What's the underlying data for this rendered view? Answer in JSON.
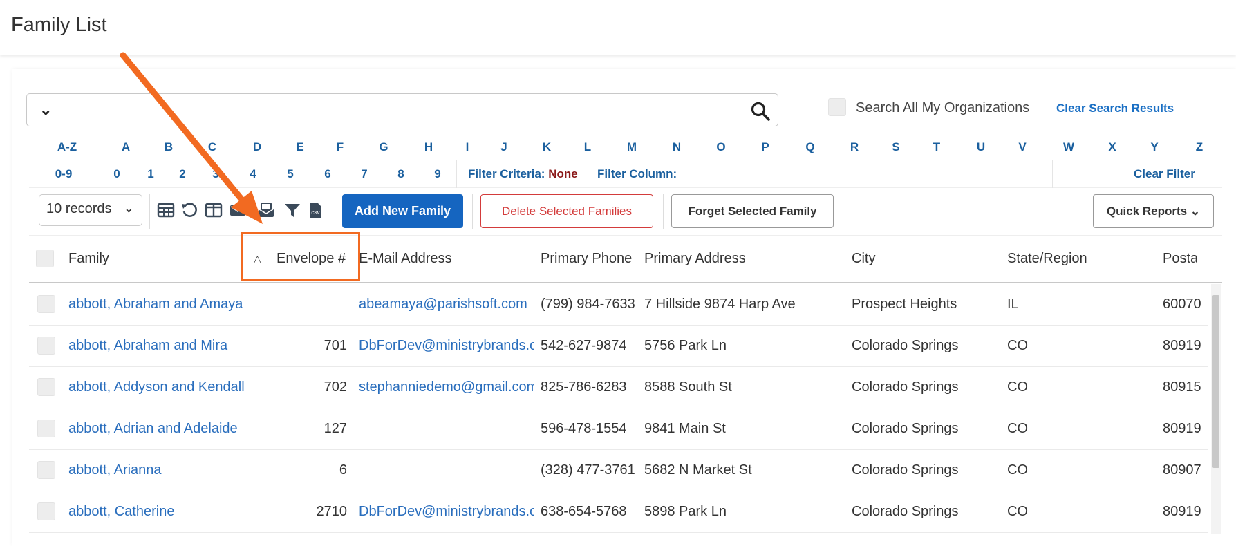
{
  "page": {
    "title": "Family List"
  },
  "search": {
    "placeholder": "",
    "search_all_label": "Search All My Organizations",
    "clear_results_label": "Clear Search Results"
  },
  "alphabet": [
    "A-Z",
    "A",
    "B",
    "C",
    "D",
    "E",
    "F",
    "G",
    "H",
    "I",
    "J",
    "K",
    "L",
    "M",
    "N",
    "O",
    "P",
    "Q",
    "R",
    "S",
    "T",
    "U",
    "V",
    "W",
    "X",
    "Y",
    "Z"
  ],
  "numbers": [
    "0-9",
    "0",
    "1",
    "2",
    "3",
    "4",
    "5",
    "6",
    "7",
    "8",
    "9"
  ],
  "filter": {
    "criteria_label": "Filter Criteria:",
    "criteria_value": "None",
    "column_label": "Filter Column:",
    "clear_label": "Clear Filter"
  },
  "toolbar": {
    "records_value": "10 records",
    "icons": [
      "table-icon",
      "refresh-icon",
      "columns-icon",
      "mail-icon",
      "mail-merge-icon",
      "filter-icon",
      "csv-icon"
    ],
    "add_label": "Add New Family",
    "delete_label": "Delete Selected Families",
    "forget_label": "Forget Selected Family",
    "quick_reports_label": "Quick Reports"
  },
  "table": {
    "headers": {
      "family": "Family",
      "envelope": "Envelope #",
      "email": "E-Mail Address",
      "phone": "Primary Phone",
      "address": "Primary Address",
      "city": "City",
      "state": "State/Region",
      "postal": "Postal Code"
    },
    "rows": [
      {
        "family": "abbott, Abraham and Amaya",
        "envelope": "",
        "email": "abeamaya@parishsoft.com",
        "phone": "(799) 984-7633",
        "address": "7 Hillside 9874 Harp Ave",
        "city": "Prospect Heights",
        "state": "IL",
        "postal": "60070"
      },
      {
        "family": "abbott, Abraham and Mira",
        "envelope": "701",
        "email": "DbForDev@ministrybrands.com",
        "phone": "542-627-9874",
        "address": "5756 Park Ln",
        "city": "Colorado Springs",
        "state": "CO",
        "postal": "80919"
      },
      {
        "family": "abbott, Addyson and Kendall",
        "envelope": "702",
        "email": "stephanniedemo@gmail.com",
        "phone": "825-786-6283",
        "address": "8588 South St",
        "city": "Colorado Springs",
        "state": "CO",
        "postal": "80915"
      },
      {
        "family": "abbott, Adrian and Adelaide",
        "envelope": "127",
        "email": "",
        "phone": "596-478-1554",
        "address": "9841 Main St",
        "city": "Colorado Springs",
        "state": "CO",
        "postal": "80919"
      },
      {
        "family": "abbott, Arianna",
        "envelope": "6",
        "email": "",
        "phone": "(328) 477-3761",
        "address": "5682 N Market St",
        "city": "Colorado Springs",
        "state": "CO",
        "postal": "80907"
      },
      {
        "family": "abbott, Catherine",
        "envelope": "2710",
        "email": "DbForDev@ministrybrands.com",
        "phone": "638-654-5768",
        "address": "5898 Park Ln",
        "city": "Colorado Springs",
        "state": "CO",
        "postal": "80919"
      }
    ]
  },
  "colors": {
    "link": "#2a6ebd",
    "primary_button": "#1565c0",
    "danger": "#d33b3b",
    "annotation": "#f26a21"
  }
}
